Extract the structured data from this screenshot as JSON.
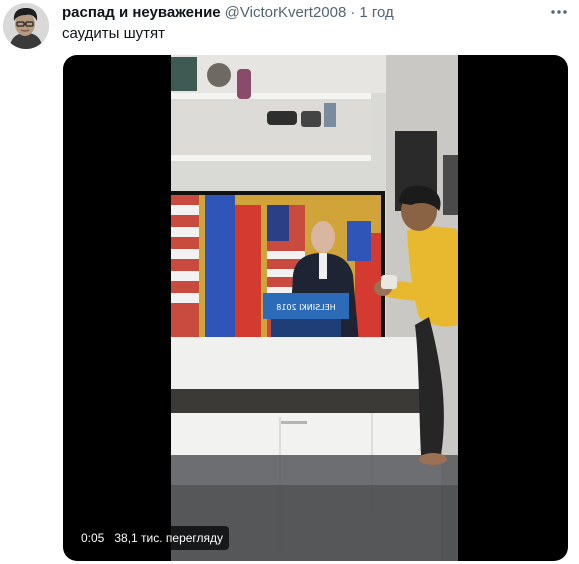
{
  "tweet": {
    "display_name": "распад и неуважение",
    "handle": "@VictorKvert2008",
    "separator": "·",
    "time": "1 год",
    "text": "саудиты шутят"
  },
  "media": {
    "type": "video",
    "current_time": "0:05",
    "views": "38,1 тис. перегляду",
    "scene_sign": "HELSINKI 2018",
    "scene_description_icon": "video-thumbnail"
  },
  "icons": {
    "more": "more-horizontal-icon",
    "avatar": "user-avatar"
  },
  "colors": {
    "text_primary": "#0f1419",
    "text_secondary": "#536471",
    "media_background": "#000000",
    "overlay_background": "#000000b8",
    "shirt_yellow": "#e8b92e"
  }
}
